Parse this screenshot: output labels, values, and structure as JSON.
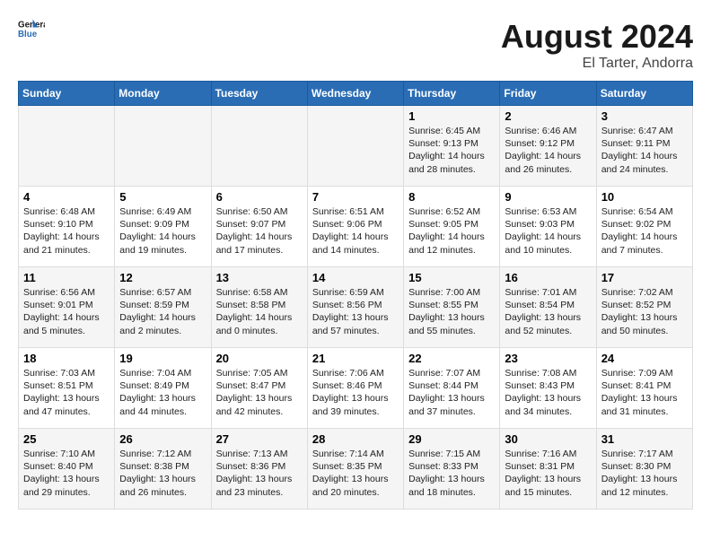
{
  "logo": {
    "line1": "General",
    "line2": "Blue"
  },
  "title": "August 2024",
  "subtitle": "El Tarter, Andorra",
  "days_of_week": [
    "Sunday",
    "Monday",
    "Tuesday",
    "Wednesday",
    "Thursday",
    "Friday",
    "Saturday"
  ],
  "weeks": [
    [
      {
        "day": "",
        "info": ""
      },
      {
        "day": "",
        "info": ""
      },
      {
        "day": "",
        "info": ""
      },
      {
        "day": "",
        "info": ""
      },
      {
        "day": "1",
        "info": "Sunrise: 6:45 AM\nSunset: 9:13 PM\nDaylight: 14 hours\nand 28 minutes."
      },
      {
        "day": "2",
        "info": "Sunrise: 6:46 AM\nSunset: 9:12 PM\nDaylight: 14 hours\nand 26 minutes."
      },
      {
        "day": "3",
        "info": "Sunrise: 6:47 AM\nSunset: 9:11 PM\nDaylight: 14 hours\nand 24 minutes."
      }
    ],
    [
      {
        "day": "4",
        "info": "Sunrise: 6:48 AM\nSunset: 9:10 PM\nDaylight: 14 hours\nand 21 minutes."
      },
      {
        "day": "5",
        "info": "Sunrise: 6:49 AM\nSunset: 9:09 PM\nDaylight: 14 hours\nand 19 minutes."
      },
      {
        "day": "6",
        "info": "Sunrise: 6:50 AM\nSunset: 9:07 PM\nDaylight: 14 hours\nand 17 minutes."
      },
      {
        "day": "7",
        "info": "Sunrise: 6:51 AM\nSunset: 9:06 PM\nDaylight: 14 hours\nand 14 minutes."
      },
      {
        "day": "8",
        "info": "Sunrise: 6:52 AM\nSunset: 9:05 PM\nDaylight: 14 hours\nand 12 minutes."
      },
      {
        "day": "9",
        "info": "Sunrise: 6:53 AM\nSunset: 9:03 PM\nDaylight: 14 hours\nand 10 minutes."
      },
      {
        "day": "10",
        "info": "Sunrise: 6:54 AM\nSunset: 9:02 PM\nDaylight: 14 hours\nand 7 minutes."
      }
    ],
    [
      {
        "day": "11",
        "info": "Sunrise: 6:56 AM\nSunset: 9:01 PM\nDaylight: 14 hours\nand 5 minutes."
      },
      {
        "day": "12",
        "info": "Sunrise: 6:57 AM\nSunset: 8:59 PM\nDaylight: 14 hours\nand 2 minutes."
      },
      {
        "day": "13",
        "info": "Sunrise: 6:58 AM\nSunset: 8:58 PM\nDaylight: 14 hours\nand 0 minutes."
      },
      {
        "day": "14",
        "info": "Sunrise: 6:59 AM\nSunset: 8:56 PM\nDaylight: 13 hours\nand 57 minutes."
      },
      {
        "day": "15",
        "info": "Sunrise: 7:00 AM\nSunset: 8:55 PM\nDaylight: 13 hours\nand 55 minutes."
      },
      {
        "day": "16",
        "info": "Sunrise: 7:01 AM\nSunset: 8:54 PM\nDaylight: 13 hours\nand 52 minutes."
      },
      {
        "day": "17",
        "info": "Sunrise: 7:02 AM\nSunset: 8:52 PM\nDaylight: 13 hours\nand 50 minutes."
      }
    ],
    [
      {
        "day": "18",
        "info": "Sunrise: 7:03 AM\nSunset: 8:51 PM\nDaylight: 13 hours\nand 47 minutes."
      },
      {
        "day": "19",
        "info": "Sunrise: 7:04 AM\nSunset: 8:49 PM\nDaylight: 13 hours\nand 44 minutes."
      },
      {
        "day": "20",
        "info": "Sunrise: 7:05 AM\nSunset: 8:47 PM\nDaylight: 13 hours\nand 42 minutes."
      },
      {
        "day": "21",
        "info": "Sunrise: 7:06 AM\nSunset: 8:46 PM\nDaylight: 13 hours\nand 39 minutes."
      },
      {
        "day": "22",
        "info": "Sunrise: 7:07 AM\nSunset: 8:44 PM\nDaylight: 13 hours\nand 37 minutes."
      },
      {
        "day": "23",
        "info": "Sunrise: 7:08 AM\nSunset: 8:43 PM\nDaylight: 13 hours\nand 34 minutes."
      },
      {
        "day": "24",
        "info": "Sunrise: 7:09 AM\nSunset: 8:41 PM\nDaylight: 13 hours\nand 31 minutes."
      }
    ],
    [
      {
        "day": "25",
        "info": "Sunrise: 7:10 AM\nSunset: 8:40 PM\nDaylight: 13 hours\nand 29 minutes."
      },
      {
        "day": "26",
        "info": "Sunrise: 7:12 AM\nSunset: 8:38 PM\nDaylight: 13 hours\nand 26 minutes."
      },
      {
        "day": "27",
        "info": "Sunrise: 7:13 AM\nSunset: 8:36 PM\nDaylight: 13 hours\nand 23 minutes."
      },
      {
        "day": "28",
        "info": "Sunrise: 7:14 AM\nSunset: 8:35 PM\nDaylight: 13 hours\nand 20 minutes."
      },
      {
        "day": "29",
        "info": "Sunrise: 7:15 AM\nSunset: 8:33 PM\nDaylight: 13 hours\nand 18 minutes."
      },
      {
        "day": "30",
        "info": "Sunrise: 7:16 AM\nSunset: 8:31 PM\nDaylight: 13 hours\nand 15 minutes."
      },
      {
        "day": "31",
        "info": "Sunrise: 7:17 AM\nSunset: 8:30 PM\nDaylight: 13 hours\nand 12 minutes."
      }
    ]
  ]
}
